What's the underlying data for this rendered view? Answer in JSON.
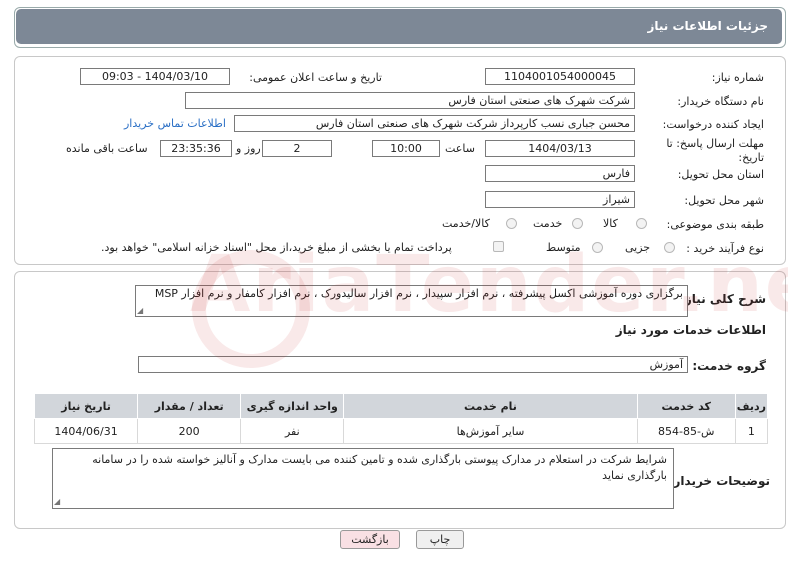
{
  "header": {
    "title": "جزئیات اطلاعات نیاز"
  },
  "form": {
    "need_number": {
      "label": "شماره نیاز:",
      "value": "1104001054000045"
    },
    "announce_datetime": {
      "label": "تاریخ و ساعت اعلان عمومی:",
      "value": "1404/03/10 - 09:03"
    },
    "buyer_org": {
      "label": "نام دستگاه خریدار:",
      "value": "شرکت شهرک های صنعتی استان فارس"
    },
    "creator": {
      "label": "ایجاد کننده درخواست:",
      "value": "محسن  جباری نسب کارپرداز شرکت شهرک های صنعتی استان فارس"
    },
    "contact_link": "اطلاعات تماس خریدار",
    "deadline": {
      "label": "مهلت ارسال پاسخ: تا تاریخ:",
      "date": "1404/03/13",
      "time_label": "ساعت",
      "time": "10:00",
      "days": "2",
      "days_label": "روز و",
      "remaining": "23:35:36",
      "remaining_label": "ساعت باقی مانده"
    },
    "province": {
      "label": "استان محل تحویل:",
      "value": "فارس"
    },
    "city": {
      "label": "شهر محل تحویل:",
      "value": "شیراز"
    },
    "category": {
      "label": "طبقه بندی موضوعی:",
      "options": [
        "کالا",
        "خدمت",
        "کالا/خدمت"
      ]
    },
    "process": {
      "label": "نوع فرآیند خرید :",
      "options": [
        "جزیی",
        "متوسط"
      ],
      "note": "پرداخت تمام یا بخشی از مبلغ خرید،از محل \"اسناد خزانه اسلامی\" خواهد بود."
    }
  },
  "summary": {
    "label": "شرح کلی نیاز:",
    "value": "برگزاری دوره آموزشی اکسل پیشرفته ، نرم افزار سپیدار ، نرم افزار سالیدورک ، نرم افزار کامفار و نرم افزار MSP"
  },
  "services": {
    "title": "اطلاعات خدمات مورد نیاز",
    "group_label": "گروه خدمت:",
    "group_value": "آموزش",
    "columns": [
      "ردیف",
      "کد خدمت",
      "نام خدمت",
      "واحد اندازه گیری",
      "تعداد / مقدار",
      "تاریخ نیاز"
    ],
    "rows": [
      {
        "row": "1",
        "code": "ش-85-854",
        "name": "سایر آموزش‌ها",
        "unit": "نفر",
        "qty": "200",
        "date": "1404/06/31"
      }
    ]
  },
  "buyer_notes": {
    "label": "توضیحات خریدار:",
    "value": "شرایط شرکت در استعلام در مدارک پیوستی بارگذاری شده و تامین کننده می بایست مدارک و آنالیز خواسته شده را در سامانه بارگذاری نماید"
  },
  "buttons": {
    "print": "چاپ",
    "back": "بازگشت"
  },
  "watermark": "AriaTender.neT"
}
